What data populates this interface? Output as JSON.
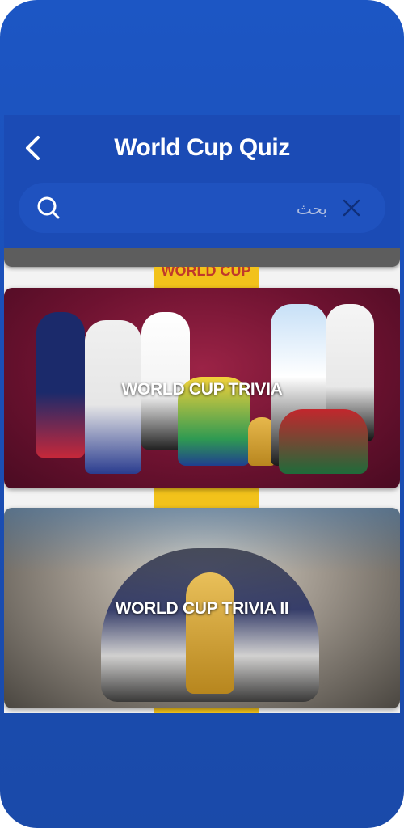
{
  "app": {
    "title": "World Cup Quiz"
  },
  "search": {
    "placeholder": "بحث",
    "value": ""
  },
  "banner": {
    "text": "WORLD CUP"
  },
  "cards": [
    {
      "title": "WORLD CUP TRIVIA"
    },
    {
      "title": "WORLD CUP TRIVIA II"
    }
  ],
  "colors": {
    "frame": "#1b4fb7",
    "header": "#1b4bb5",
    "search_bg": "#1f52bf",
    "card1_bg": "#7d1634",
    "card2_bg": "#6f6b66",
    "accent_yellow": "#f2c21b"
  },
  "icons": [
    "back-arrow-icon",
    "search-icon",
    "close-icon"
  ]
}
